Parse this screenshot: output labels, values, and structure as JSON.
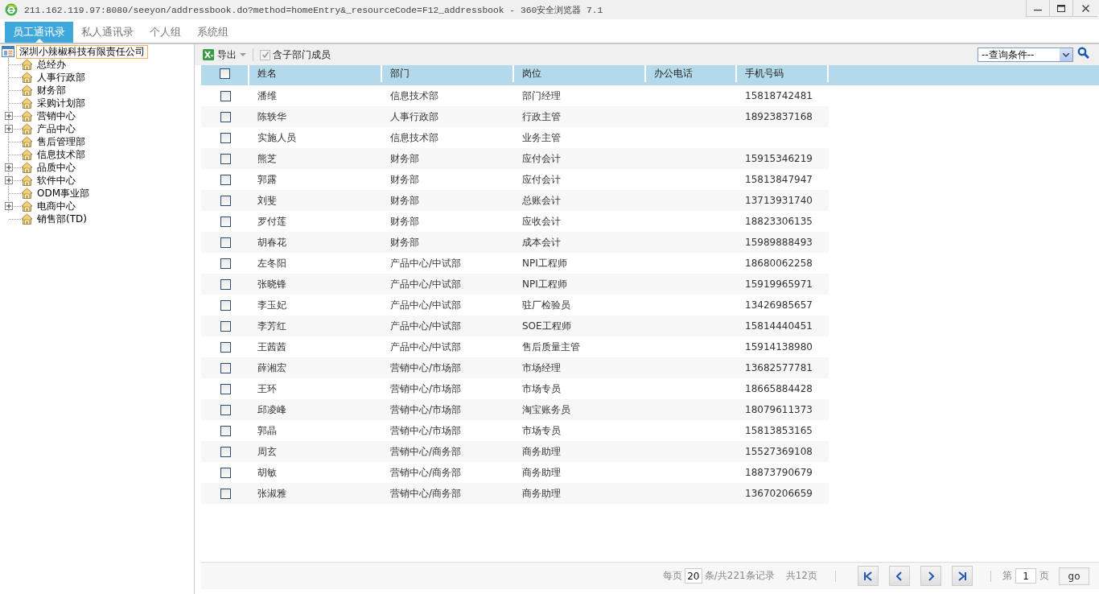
{
  "window": {
    "title": "211.162.119.97:8080/seeyon/addressbook.do?method=homeEntry&_resourceCode=F12_addressbook - 360安全浏览器 7.1"
  },
  "tabs": [
    {
      "label": "员工通讯录",
      "selected": true
    },
    {
      "label": "私人通讯录",
      "selected": false
    },
    {
      "label": "个人组",
      "selected": false
    },
    {
      "label": "系统组",
      "selected": false
    }
  ],
  "tree": {
    "root": "深圳小辣椒科技有限责任公司",
    "children": [
      {
        "label": "总经办",
        "collapsed": false
      },
      {
        "label": "人事行政部",
        "collapsed": false
      },
      {
        "label": "财务部",
        "collapsed": false
      },
      {
        "label": "采购计划部",
        "collapsed": false
      },
      {
        "label": "营销中心",
        "collapsed": true
      },
      {
        "label": "产品中心",
        "collapsed": true
      },
      {
        "label": "售后管理部",
        "collapsed": false
      },
      {
        "label": "信息技术部",
        "collapsed": false
      },
      {
        "label": "品质中心",
        "collapsed": true
      },
      {
        "label": "软件中心",
        "collapsed": true
      },
      {
        "label": "ODM事业部",
        "collapsed": false
      },
      {
        "label": "电商中心",
        "collapsed": true
      },
      {
        "label": "销售部(TD)",
        "collapsed": false
      }
    ]
  },
  "toolbar": {
    "export": "导出",
    "include_sub": {
      "label": "含子部门成员",
      "checked": true
    },
    "query": "--查询条件--"
  },
  "table": {
    "columns": [
      "姓名",
      "部门",
      "岗位",
      "办公电话",
      "手机号码"
    ],
    "header_checked": false,
    "rows": [
      {
        "checked": false,
        "name": "潘维",
        "dept": "信息技术部",
        "post": "部门经理",
        "mobile": "15818742481"
      },
      {
        "checked": false,
        "name": "陈轶华",
        "dept": "人事行政部",
        "post": "行政主管",
        "mobile": "18923837168"
      },
      {
        "checked": false,
        "name": "实施人员",
        "dept": "信息技术部",
        "post": "业务主管"
      },
      {
        "checked": false,
        "name": "熊芝",
        "dept": "财务部",
        "post": "应付会计",
        "mobile": "15915346219"
      },
      {
        "checked": false,
        "name": "郭露",
        "dept": "财务部",
        "post": "应付会计",
        "mobile": "15813847947"
      },
      {
        "checked": false,
        "name": "刘斐",
        "dept": "财务部",
        "post": "总账会计",
        "mobile": "13713931740"
      },
      {
        "checked": false,
        "name": "罗付莲",
        "dept": "财务部",
        "post": "应收会计",
        "mobile": "18823306135"
      },
      {
        "checked": false,
        "name": "胡春花",
        "dept": "财务部",
        "post": "成本会计",
        "mobile": "15989888493"
      },
      {
        "checked": false,
        "name": "左冬阳",
        "dept": "产品中心/中试部",
        "post": "NPI工程师",
        "mobile": "18680062258"
      },
      {
        "checked": false,
        "name": "张晓锋",
        "dept": "产品中心/中试部",
        "post": "NPI工程师",
        "mobile": "15919965971"
      },
      {
        "checked": false,
        "name": "李玉妃",
        "dept": "产品中心/中试部",
        "post": "驻厂检验员",
        "mobile": "13426985657"
      },
      {
        "checked": false,
        "name": "李芳红",
        "dept": "产品中心/中试部",
        "post": "SOE工程师",
        "mobile": "15814440451"
      },
      {
        "checked": false,
        "name": "王茜茜",
        "dept": "产品中心/中试部",
        "post": "售后质量主管",
        "mobile": "15914138980"
      },
      {
        "checked": false,
        "name": "薛湘宏",
        "dept": "营销中心/市场部",
        "post": "市场经理",
        "mobile": "13682577781"
      },
      {
        "checked": false,
        "name": "王环",
        "dept": "营销中心/市场部",
        "post": "市场专员",
        "mobile": "18665884428"
      },
      {
        "checked": false,
        "name": "邱凌峰",
        "dept": "营销中心/市场部",
        "post": "淘宝账务员",
        "mobile": "18079611373"
      },
      {
        "checked": false,
        "name": "郭晶",
        "dept": "营销中心/市场部",
        "post": "市场专员",
        "mobile": "15813853165"
      },
      {
        "checked": false,
        "name": "周玄",
        "dept": "营销中心/商务部",
        "post": "商务助理",
        "mobile": "15527369108"
      },
      {
        "checked": false,
        "name": "胡敏",
        "dept": "营销中心/商务部",
        "post": "商务助理",
        "mobile": "18873790679"
      },
      {
        "checked": false,
        "name": "张淑雅",
        "dept": "营销中心/商务部",
        "post": "商务助理",
        "mobile": "13670206659"
      }
    ]
  },
  "pager": {
    "per_page_label": "每页",
    "per_page": "20",
    "records": "条/共221条记录",
    "pages": "共12页",
    "page_prefix": "第",
    "page": "1",
    "page_suffix": "页",
    "go": "go"
  }
}
